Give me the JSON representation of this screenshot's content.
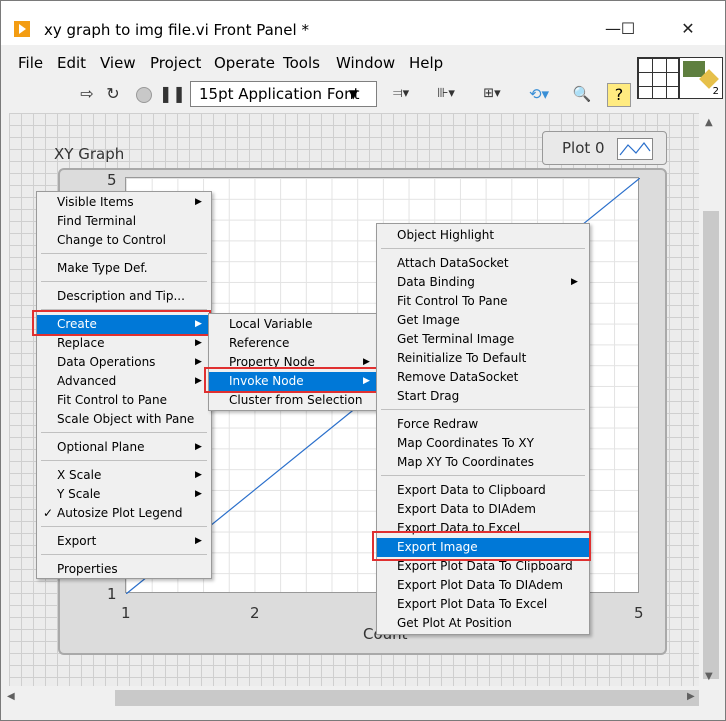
{
  "window": {
    "title": "xy graph to img file.vi Front Panel *",
    "minimize": "—",
    "maximize": "☐",
    "close": "✕"
  },
  "menubar": [
    "File",
    "Edit",
    "View",
    "Project",
    "Operate",
    "Tools",
    "Window",
    "Help"
  ],
  "toolbar": {
    "font_select": "15pt Application Font",
    "run_icon": "run-arrow-icon",
    "run_continuous_icon": "run-continuously-icon",
    "abort_icon": "abort-icon",
    "pause_icon": "pause-icon",
    "help_label": "?",
    "vi_icon_number": "2"
  },
  "graph": {
    "label": "XY Graph",
    "legend_name": "Plot 0",
    "x_axis_label": "Count",
    "y_ticks": [
      "5",
      "1"
    ],
    "x_ticks": [
      "1",
      "2",
      "5"
    ],
    "line_color": "#2a6fcb"
  },
  "context_menu": {
    "items": [
      "Visible Items",
      "Find Terminal",
      "Change to Control",
      "Make Type Def.",
      "Description and Tip...",
      "Create",
      "Replace",
      "Data Operations",
      "Advanced",
      "Fit Control to Pane",
      "Scale Object with Pane",
      "Optional Plane",
      "X Scale",
      "Y Scale",
      "Autosize Plot Legend",
      "Export",
      "Properties"
    ]
  },
  "create_menu": {
    "items": [
      "Local Variable",
      "Reference",
      "Property Node",
      "Invoke Node",
      "Cluster from Selection"
    ]
  },
  "invoke_menu": {
    "items": [
      "Object Highlight",
      "Attach DataSocket",
      "Data Binding",
      "Fit Control To Pane",
      "Get Image",
      "Get Terminal Image",
      "Reinitialize To Default",
      "Remove DataSocket",
      "Start Drag",
      "Force Redraw",
      "Map Coordinates To XY",
      "Map XY To Coordinates",
      "Export Data to Clipboard",
      "Export Data to DIAdem",
      "Export Data to Excel",
      "Export Image",
      "Export Plot Data To Clipboard",
      "Export Plot Data To DIAdem",
      "Export Plot Data To Excel",
      "Get Plot At Position"
    ]
  },
  "colors": {
    "highlight": "#0078d7",
    "annotation_box": "#e03030"
  }
}
